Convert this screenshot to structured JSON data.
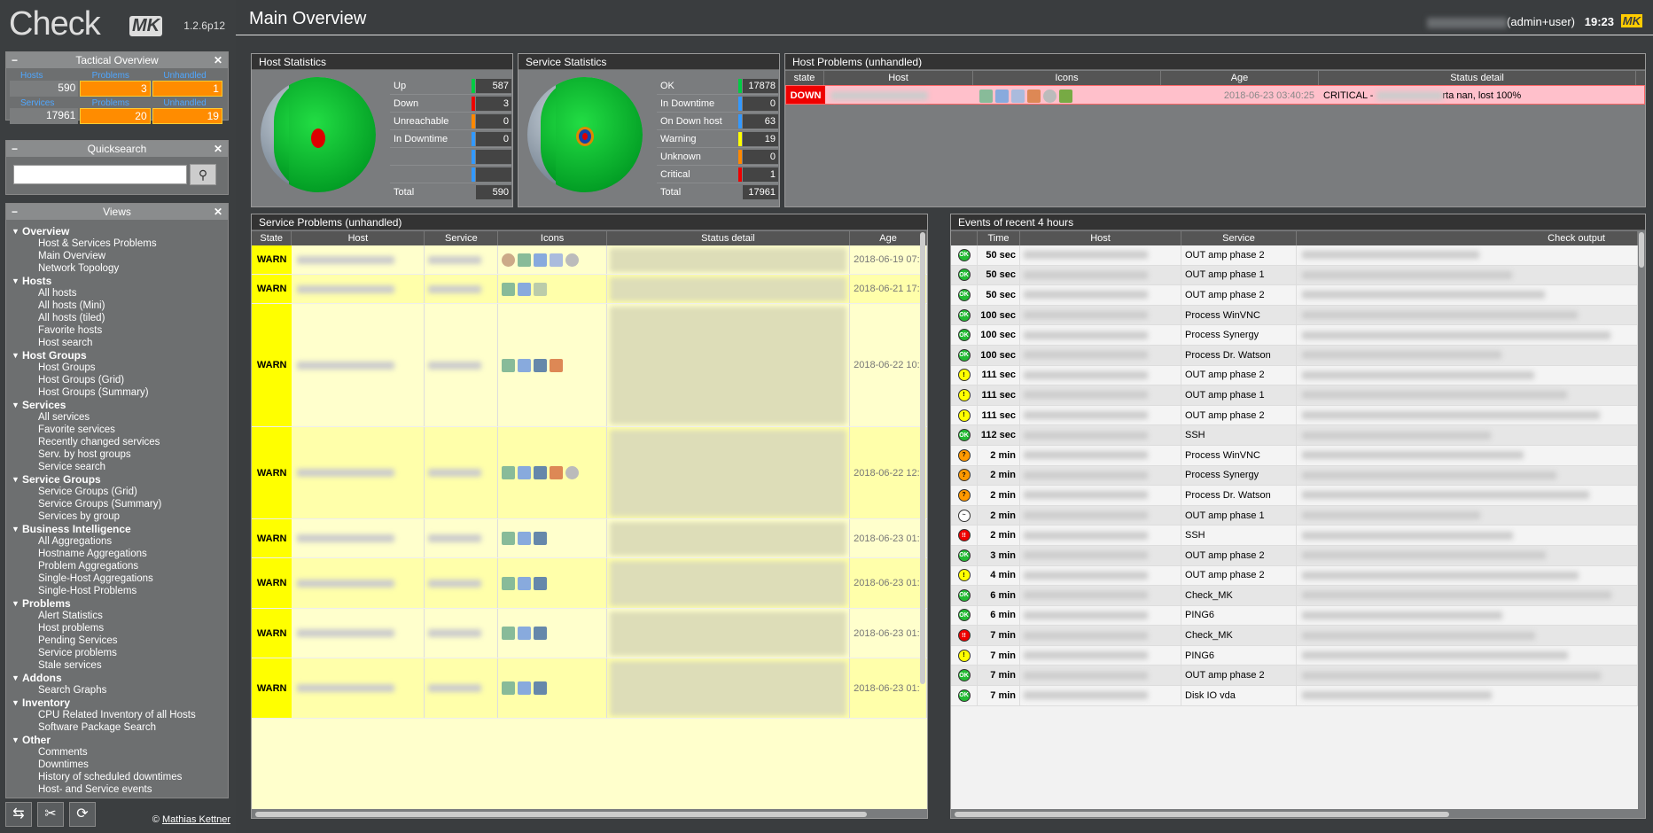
{
  "app": {
    "logo_text": "Check",
    "logo_mk": "MK",
    "version": "1.2.6p12"
  },
  "sidebar": {
    "tactical": {
      "title": "Tactical Overview",
      "row1_labels": [
        "Hosts",
        "Problems",
        "Unhandled"
      ],
      "row1_values": [
        "590",
        "3",
        "1"
      ],
      "row2_labels": [
        "Services",
        "Problems",
        "Unhandled"
      ],
      "row2_values": [
        "17961",
        "20",
        "19"
      ]
    },
    "quicksearch": {
      "title": "Quicksearch",
      "placeholder": ""
    },
    "views": {
      "title": "Views",
      "groups": [
        {
          "label": "Overview",
          "items": [
            "Host & Services Problems",
            "Main Overview",
            "Network Topology"
          ]
        },
        {
          "label": "Hosts",
          "items": [
            "All hosts",
            "All hosts (Mini)",
            "All hosts (tiled)",
            "Favorite hosts",
            "Host search"
          ]
        },
        {
          "label": "Host Groups",
          "items": [
            "Host Groups",
            "Host Groups (Grid)",
            "Host Groups (Summary)"
          ]
        },
        {
          "label": "Services",
          "items": [
            "All services",
            "Favorite services",
            "Recently changed services",
            "Serv. by host groups",
            "Service search"
          ]
        },
        {
          "label": "Service Groups",
          "items": [
            "Service Groups (Grid)",
            "Service Groups (Summary)",
            "Services by group"
          ]
        },
        {
          "label": "Business Intelligence",
          "items": [
            "All Aggregations",
            "Hostname Aggregations",
            "Problem Aggregations",
            "Single-Host Aggregations",
            "Single-Host Problems"
          ]
        },
        {
          "label": "Problems",
          "items": [
            "Alert Statistics",
            "Host problems",
            "Pending Services",
            "Service problems",
            "Stale services"
          ]
        },
        {
          "label": "Addons",
          "items": [
            "Search Graphs"
          ]
        },
        {
          "label": "Inventory",
          "items": [
            "CPU Related Inventory of all Hosts",
            "Software Package Search"
          ]
        },
        {
          "label": "Other",
          "items": [
            "Comments",
            "Downtimes",
            "History of scheduled downtimes",
            "Host- and Service events"
          ]
        }
      ]
    },
    "credit_prefix": "©",
    "credit_name": "Mathias Kettner"
  },
  "header": {
    "title": "Main Overview",
    "user": "(admin+user)",
    "clock": "19:23",
    "logo": "MK"
  },
  "host_stats": {
    "title": "Host Statistics",
    "rows": [
      {
        "label": "Up",
        "value": "587",
        "color": "#00cc44"
      },
      {
        "label": "Down",
        "value": "3",
        "color": "#ee0000"
      },
      {
        "label": "Unreachable",
        "value": "0",
        "color": "#ff8800"
      },
      {
        "label": "In Downtime",
        "value": "0",
        "color": "#3399ff"
      },
      {
        "label": "",
        "value": "",
        "color": "#3399ff"
      },
      {
        "label": "",
        "value": "",
        "color": "#3399ff"
      }
    ],
    "total_label": "Total",
    "total": "590"
  },
  "service_stats": {
    "title": "Service Statistics",
    "rows": [
      {
        "label": "OK",
        "value": "17878",
        "color": "#00cc44"
      },
      {
        "label": "In Downtime",
        "value": "0",
        "color": "#3399ff"
      },
      {
        "label": "On Down host",
        "value": "63",
        "color": "#3399ff"
      },
      {
        "label": "Warning",
        "value": "19",
        "color": "#ffff00"
      },
      {
        "label": "Unknown",
        "value": "0",
        "color": "#ff8800"
      },
      {
        "label": "Critical",
        "value": "1",
        "color": "#ee0000"
      }
    ],
    "total_label": "Total",
    "total": "17961"
  },
  "host_problems": {
    "title": "Host Problems (unhandled)",
    "columns": [
      "state",
      "Host",
      "Icons",
      "Age",
      "Status detail"
    ],
    "rows": [
      {
        "state": "DOWN",
        "age": "2018-06-23 03:40:25",
        "detail_prefix": "CRITICAL - ",
        "detail_suffix": "rta nan, lost 100%"
      }
    ]
  },
  "service_problems": {
    "title": "Service Problems (unhandled)",
    "columns": [
      "State",
      "Host",
      "Service",
      "Icons",
      "Status detail",
      "Age"
    ],
    "rows": [
      {
        "state": "WARN",
        "age": "2018-06-19 07:",
        "h": 33,
        "icons": [
          "pie",
          "refresh",
          "ack",
          "graph",
          "moon"
        ]
      },
      {
        "state": "WARN",
        "age": "2018-06-21 17:",
        "h": 33,
        "icons": [
          "refresh",
          "ack",
          "notes"
        ]
      },
      {
        "state": "WARN",
        "age": "2018-06-22 10:",
        "h": 139,
        "icons": [
          "refresh",
          "ack",
          "printer",
          "ext"
        ]
      },
      {
        "state": "WARN",
        "age": "2018-06-22 12:",
        "h": 104,
        "icons": [
          "refresh",
          "ack",
          "printer",
          "ext",
          "moon"
        ]
      },
      {
        "state": "WARN",
        "age": "2018-06-23 01:",
        "h": 44,
        "icons": [
          "refresh",
          "ack",
          "printer"
        ]
      },
      {
        "state": "WARN",
        "age": "2018-06-23 01:",
        "h": 57,
        "icons": [
          "refresh",
          "ack",
          "printer"
        ]
      },
      {
        "state": "WARN",
        "age": "2018-06-23 01:",
        "h": 56,
        "icons": [
          "refresh",
          "ack",
          "printer"
        ]
      },
      {
        "state": "WARN",
        "age": "2018-06-23 01:",
        "h": 68,
        "icons": [
          "refresh",
          "ack",
          "printer"
        ]
      }
    ]
  },
  "events": {
    "title": "Events of recent 4 hours",
    "columns": [
      "",
      "Time",
      "Host",
      "Service",
      "Check output"
    ],
    "rows": [
      {
        "icon": "ok",
        "icon_text": "OK",
        "time": "50 sec",
        "service": "OUT amp phase 2"
      },
      {
        "icon": "ok",
        "icon_text": "OK",
        "time": "50 sec",
        "service": "OUT amp phase 1"
      },
      {
        "icon": "ok",
        "icon_text": "OK",
        "time": "50 sec",
        "service": "OUT amp phase 2"
      },
      {
        "icon": "ok",
        "icon_text": "OK",
        "time": "100 sec",
        "service": "Process WinVNC"
      },
      {
        "icon": "ok",
        "icon_text": "OK",
        "time": "100 sec",
        "service": "Process Synergy"
      },
      {
        "icon": "ok",
        "icon_text": "OK",
        "time": "100 sec",
        "service": "Process Dr. Watson"
      },
      {
        "icon": "warn",
        "icon_text": "!",
        "time": "111 sec",
        "service": "OUT amp phase 2"
      },
      {
        "icon": "warn",
        "icon_text": "!",
        "time": "111 sec",
        "service": "OUT amp phase 1"
      },
      {
        "icon": "warn",
        "icon_text": "!",
        "time": "111 sec",
        "service": "OUT amp phase 2"
      },
      {
        "icon": "ok",
        "icon_text": "OK",
        "time": "112 sec",
        "service": "SSH"
      },
      {
        "icon": "unk",
        "icon_text": "?",
        "time": "2 min",
        "service": "Process WinVNC"
      },
      {
        "icon": "unk",
        "icon_text": "?",
        "time": "2 min",
        "service": "Process Synergy"
      },
      {
        "icon": "unk",
        "icon_text": "?",
        "time": "2 min",
        "service": "Process Dr. Watson"
      },
      {
        "icon": "flap",
        "icon_text": "~",
        "time": "2 min",
        "service": "OUT amp phase 1"
      },
      {
        "icon": "crit",
        "icon_text": "!!",
        "time": "2 min",
        "service": "SSH"
      },
      {
        "icon": "ok",
        "icon_text": "OK",
        "time": "3 min",
        "service": "OUT amp phase 2"
      },
      {
        "icon": "warn",
        "icon_text": "!",
        "time": "4 min",
        "service": "OUT amp phase 2"
      },
      {
        "icon": "ok",
        "icon_text": "OK",
        "time": "6 min",
        "service": "Check_MK"
      },
      {
        "icon": "ok",
        "icon_text": "OK",
        "time": "6 min",
        "service": "PING6"
      },
      {
        "icon": "crit",
        "icon_text": "!!",
        "time": "7 min",
        "service": "Check_MK"
      },
      {
        "icon": "warn",
        "icon_text": "!",
        "time": "7 min",
        "service": "PING6"
      },
      {
        "icon": "ok",
        "icon_text": "OK",
        "time": "7 min",
        "service": "OUT amp phase 2"
      },
      {
        "icon": "ok",
        "icon_text": "OK",
        "time": "7 min",
        "service": "Disk IO vda"
      }
    ]
  }
}
